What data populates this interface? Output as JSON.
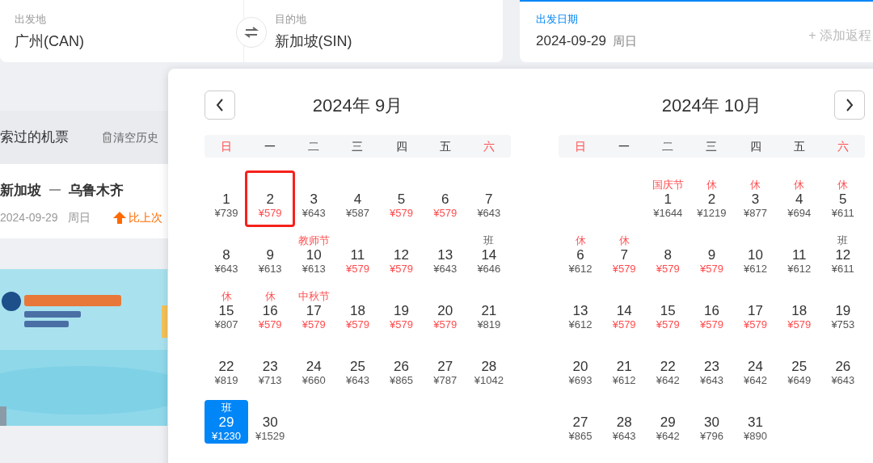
{
  "search": {
    "origin": {
      "label": "出发地",
      "value": "广州(CAN)"
    },
    "destination": {
      "label": "目的地",
      "value": "新加坡(SIN)"
    },
    "date": {
      "label": "出发日期",
      "value": "2024-09-29",
      "weekday": "周日",
      "return_link": "+ 添加返程"
    }
  },
  "history": {
    "title": "索过的机票",
    "clear": "清空历史",
    "items": [
      {
        "from": "新加坡",
        "to": "乌鲁木齐",
        "date": "2024-09-29",
        "weekday": "周日",
        "trend": "比上次"
      }
    ]
  },
  "calendar": {
    "months": [
      {
        "title": "2024年 9月",
        "weekdays": [
          {
            "label": "日",
            "weekend": true
          },
          {
            "label": "一",
            "weekend": false
          },
          {
            "label": "二",
            "weekend": false
          },
          {
            "label": "三",
            "weekend": false
          },
          {
            "label": "四",
            "weekend": false
          },
          {
            "label": "五",
            "weekend": false
          },
          {
            "label": "六",
            "weekend": true
          }
        ],
        "days": [
          {
            "kind": "day",
            "day": "1",
            "price": "¥739",
            "low": false,
            "selected": false,
            "boxed": false
          },
          {
            "kind": "day",
            "day": "2",
            "price": "¥579",
            "low": true,
            "selected": false,
            "boxed": true
          },
          {
            "kind": "day",
            "day": "3",
            "price": "¥643",
            "low": false,
            "selected": false,
            "boxed": false
          },
          {
            "kind": "day",
            "day": "4",
            "price": "¥587",
            "low": false,
            "selected": false,
            "boxed": false
          },
          {
            "kind": "day",
            "day": "5",
            "price": "¥579",
            "low": true,
            "selected": false,
            "boxed": false
          },
          {
            "kind": "day",
            "day": "6",
            "price": "¥579",
            "low": true,
            "selected": false,
            "boxed": false
          },
          {
            "kind": "day",
            "day": "7",
            "price": "¥643",
            "low": false,
            "selected": false,
            "boxed": false
          },
          {
            "kind": "day",
            "day": "8",
            "price": "¥643",
            "low": false,
            "selected": false,
            "boxed": false
          },
          {
            "kind": "day",
            "day": "9",
            "price": "¥613",
            "low": false,
            "selected": false,
            "boxed": false
          },
          {
            "kind": "day",
            "day": "10",
            "price": "¥613",
            "low": false,
            "selected": false,
            "boxed": false,
            "tag": "教师节",
            "tag_red": true
          },
          {
            "kind": "day",
            "day": "11",
            "price": "¥579",
            "low": true,
            "selected": false,
            "boxed": false
          },
          {
            "kind": "day",
            "day": "12",
            "price": "¥579",
            "low": true,
            "selected": false,
            "boxed": false
          },
          {
            "kind": "day",
            "day": "13",
            "price": "¥643",
            "low": false,
            "selected": false,
            "boxed": false
          },
          {
            "kind": "day",
            "day": "14",
            "price": "¥646",
            "low": false,
            "selected": false,
            "boxed": false,
            "tag": "班",
            "tag_red": false
          },
          {
            "kind": "day",
            "day": "15",
            "price": "¥807",
            "low": false,
            "selected": false,
            "boxed": false,
            "tag": "休",
            "tag_red": true
          },
          {
            "kind": "day",
            "day": "16",
            "price": "¥579",
            "low": true,
            "selected": false,
            "boxed": false,
            "tag": "休",
            "tag_red": true
          },
          {
            "kind": "day",
            "day": "17",
            "price": "¥579",
            "low": true,
            "selected": false,
            "boxed": false,
            "tag": "中秋节",
            "tag_red": true
          },
          {
            "kind": "day",
            "day": "18",
            "price": "¥579",
            "low": true,
            "selected": false,
            "boxed": false
          },
          {
            "kind": "day",
            "day": "19",
            "price": "¥579",
            "low": true,
            "selected": false,
            "boxed": false
          },
          {
            "kind": "day",
            "day": "20",
            "price": "¥579",
            "low": true,
            "selected": false,
            "boxed": false
          },
          {
            "kind": "day",
            "day": "21",
            "price": "¥819",
            "low": false,
            "selected": false,
            "boxed": false
          },
          {
            "kind": "day",
            "day": "22",
            "price": "¥819",
            "low": false,
            "selected": false,
            "boxed": false
          },
          {
            "kind": "day",
            "day": "23",
            "price": "¥713",
            "low": false,
            "selected": false,
            "boxed": false
          },
          {
            "kind": "day",
            "day": "24",
            "price": "¥660",
            "low": false,
            "selected": false,
            "boxed": false
          },
          {
            "kind": "day",
            "day": "25",
            "price": "¥643",
            "low": false,
            "selected": false,
            "boxed": false
          },
          {
            "kind": "day",
            "day": "26",
            "price": "¥865",
            "low": false,
            "selected": false,
            "boxed": false
          },
          {
            "kind": "day",
            "day": "27",
            "price": "¥787",
            "low": false,
            "selected": false,
            "boxed": false
          },
          {
            "kind": "day",
            "day": "28",
            "price": "¥1042",
            "low": false,
            "selected": false,
            "boxed": false
          },
          {
            "kind": "day",
            "day": "29",
            "price": "¥1230",
            "low": false,
            "selected": true,
            "boxed": false,
            "tag": "班",
            "tag_red": false
          },
          {
            "kind": "day",
            "day": "30",
            "price": "¥1529",
            "low": false,
            "selected": false,
            "boxed": false
          }
        ]
      },
      {
        "title": "2024年 10月",
        "weekdays": [
          {
            "label": "日",
            "weekend": true
          },
          {
            "label": "一",
            "weekend": false
          },
          {
            "label": "二",
            "weekend": false
          },
          {
            "label": "三",
            "weekend": false
          },
          {
            "label": "四",
            "weekend": false
          },
          {
            "label": "五",
            "weekend": false
          },
          {
            "label": "六",
            "weekend": true
          }
        ],
        "days": [
          {
            "kind": "blank"
          },
          {
            "kind": "blank"
          },
          {
            "kind": "day",
            "day": "1",
            "price": "¥1644",
            "low": false,
            "selected": false,
            "boxed": false,
            "tag": "国庆节",
            "tag_red": true
          },
          {
            "kind": "day",
            "day": "2",
            "price": "¥1219",
            "low": false,
            "selected": false,
            "boxed": false,
            "tag": "休",
            "tag_red": true
          },
          {
            "kind": "day",
            "day": "3",
            "price": "¥877",
            "low": false,
            "selected": false,
            "boxed": false,
            "tag": "休",
            "tag_red": true
          },
          {
            "kind": "day",
            "day": "4",
            "price": "¥694",
            "low": false,
            "selected": false,
            "boxed": false,
            "tag": "休",
            "tag_red": true
          },
          {
            "kind": "day",
            "day": "5",
            "price": "¥611",
            "low": false,
            "selected": false,
            "boxed": false,
            "tag": "休",
            "tag_red": true
          },
          {
            "kind": "day",
            "day": "6",
            "price": "¥612",
            "low": false,
            "selected": false,
            "boxed": false,
            "tag": "休",
            "tag_red": true
          },
          {
            "kind": "day",
            "day": "7",
            "price": "¥579",
            "low": true,
            "selected": false,
            "boxed": false,
            "tag": "休",
            "tag_red": true
          },
          {
            "kind": "day",
            "day": "8",
            "price": "¥579",
            "low": true,
            "selected": false,
            "boxed": false
          },
          {
            "kind": "day",
            "day": "9",
            "price": "¥579",
            "low": true,
            "selected": false,
            "boxed": false
          },
          {
            "kind": "day",
            "day": "10",
            "price": "¥612",
            "low": false,
            "selected": false,
            "boxed": false
          },
          {
            "kind": "day",
            "day": "11",
            "price": "¥612",
            "low": false,
            "selected": false,
            "boxed": false
          },
          {
            "kind": "day",
            "day": "12",
            "price": "¥611",
            "low": false,
            "selected": false,
            "boxed": false,
            "tag": "班",
            "tag_red": false
          },
          {
            "kind": "day",
            "day": "13",
            "price": "¥612",
            "low": false,
            "selected": false,
            "boxed": false
          },
          {
            "kind": "day",
            "day": "14",
            "price": "¥579",
            "low": true,
            "selected": false,
            "boxed": false
          },
          {
            "kind": "day",
            "day": "15",
            "price": "¥579",
            "low": true,
            "selected": false,
            "boxed": false
          },
          {
            "kind": "day",
            "day": "16",
            "price": "¥579",
            "low": true,
            "selected": false,
            "boxed": false
          },
          {
            "kind": "day",
            "day": "17",
            "price": "¥579",
            "low": true,
            "selected": false,
            "boxed": false
          },
          {
            "kind": "day",
            "day": "18",
            "price": "¥579",
            "low": true,
            "selected": false,
            "boxed": false
          },
          {
            "kind": "day",
            "day": "19",
            "price": "¥753",
            "low": false,
            "selected": false,
            "boxed": false
          },
          {
            "kind": "day",
            "day": "20",
            "price": "¥693",
            "low": false,
            "selected": false,
            "boxed": false
          },
          {
            "kind": "day",
            "day": "21",
            "price": "¥612",
            "low": false,
            "selected": false,
            "boxed": false
          },
          {
            "kind": "day",
            "day": "22",
            "price": "¥642",
            "low": false,
            "selected": false,
            "boxed": false
          },
          {
            "kind": "day",
            "day": "23",
            "price": "¥643",
            "low": false,
            "selected": false,
            "boxed": false
          },
          {
            "kind": "day",
            "day": "24",
            "price": "¥642",
            "low": false,
            "selected": false,
            "boxed": false
          },
          {
            "kind": "day",
            "day": "25",
            "price": "¥649",
            "low": false,
            "selected": false,
            "boxed": false
          },
          {
            "kind": "day",
            "day": "26",
            "price": "¥643",
            "low": false,
            "selected": false,
            "boxed": false
          },
          {
            "kind": "day",
            "day": "27",
            "price": "¥865",
            "low": false,
            "selected": false,
            "boxed": false
          },
          {
            "kind": "day",
            "day": "28",
            "price": "¥643",
            "low": false,
            "selected": false,
            "boxed": false
          },
          {
            "kind": "day",
            "day": "29",
            "price": "¥642",
            "low": false,
            "selected": false,
            "boxed": false
          },
          {
            "kind": "day",
            "day": "30",
            "price": "¥796",
            "low": false,
            "selected": false,
            "boxed": false
          },
          {
            "kind": "day",
            "day": "31",
            "price": "¥890",
            "low": false,
            "selected": false,
            "boxed": false
          }
        ]
      }
    ]
  }
}
